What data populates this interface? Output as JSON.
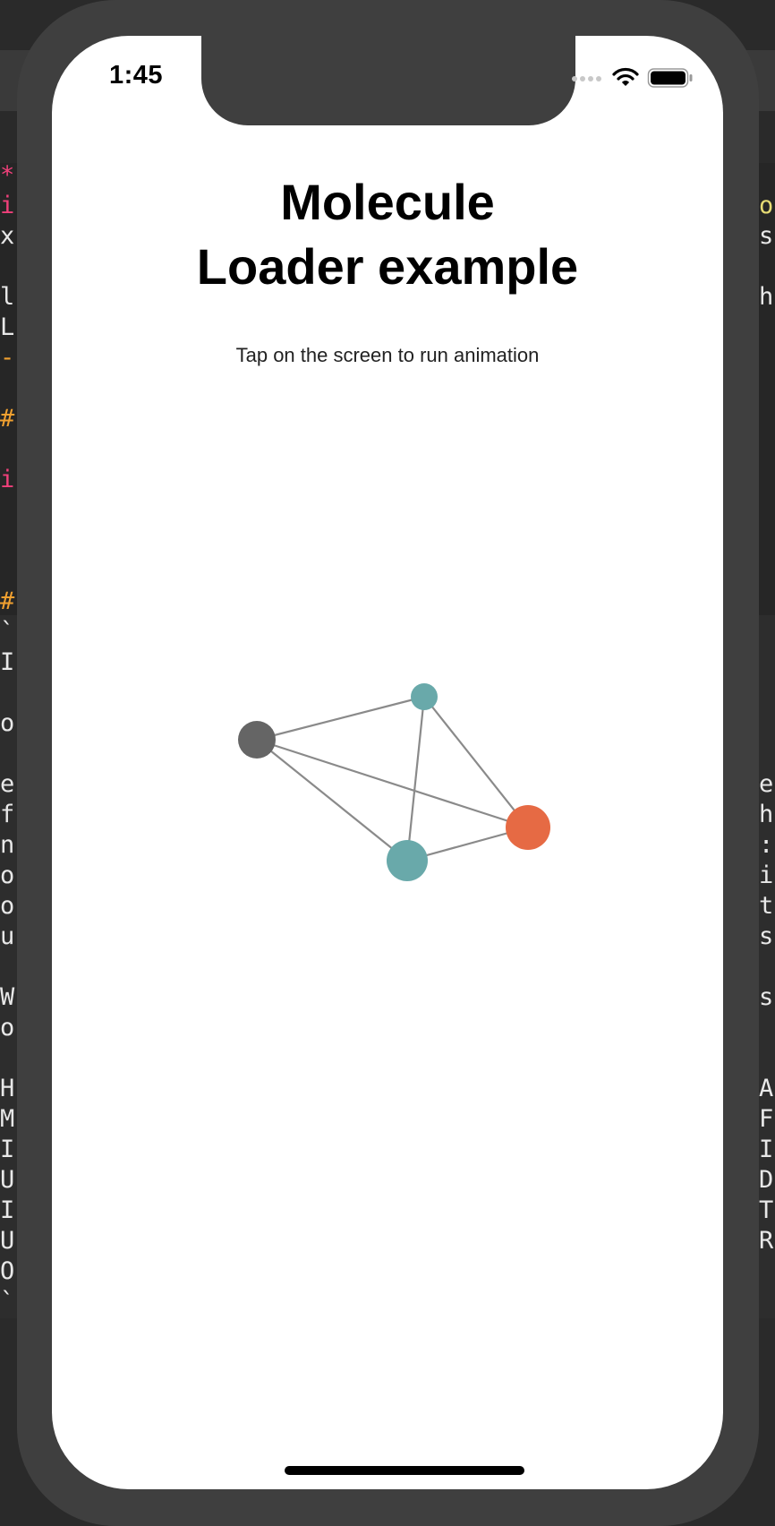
{
  "status_bar": {
    "time": "1:45",
    "icons": [
      "signal-dots-icon",
      "wifi-icon",
      "battery-icon"
    ]
  },
  "app": {
    "title_line1": "Molecule",
    "title_line2": "Loader example",
    "subtitle": "Tap on the screen to run animation"
  },
  "molecule": {
    "colors": {
      "gray": "#656565",
      "teal": "#69a9aa",
      "orange": "#e66a44",
      "bond": "#8a8a8a"
    },
    "atoms": [
      {
        "name": "atom-gray",
        "color": "gray"
      },
      {
        "name": "atom-teal-small",
        "color": "teal"
      },
      {
        "name": "atom-teal-large",
        "color": "teal"
      },
      {
        "name": "atom-orange",
        "color": "orange"
      }
    ]
  },
  "background_code": {
    "left_chars": [
      "*",
      "i",
      "x",
      "l",
      "L",
      "-",
      "#",
      "i",
      "#",
      "`",
      "I",
      "o",
      "e",
      "f",
      "n",
      "o",
      "o",
      "u",
      "W",
      "o",
      "H",
      "M",
      "I",
      "U",
      "I",
      "U",
      "O",
      "`"
    ],
    "right_chars": [
      "o",
      "s",
      "h",
      "e",
      "h",
      ":",
      "i",
      "t",
      "s",
      "s",
      "A",
      "F",
      "I",
      "D",
      "T",
      "R"
    ]
  }
}
